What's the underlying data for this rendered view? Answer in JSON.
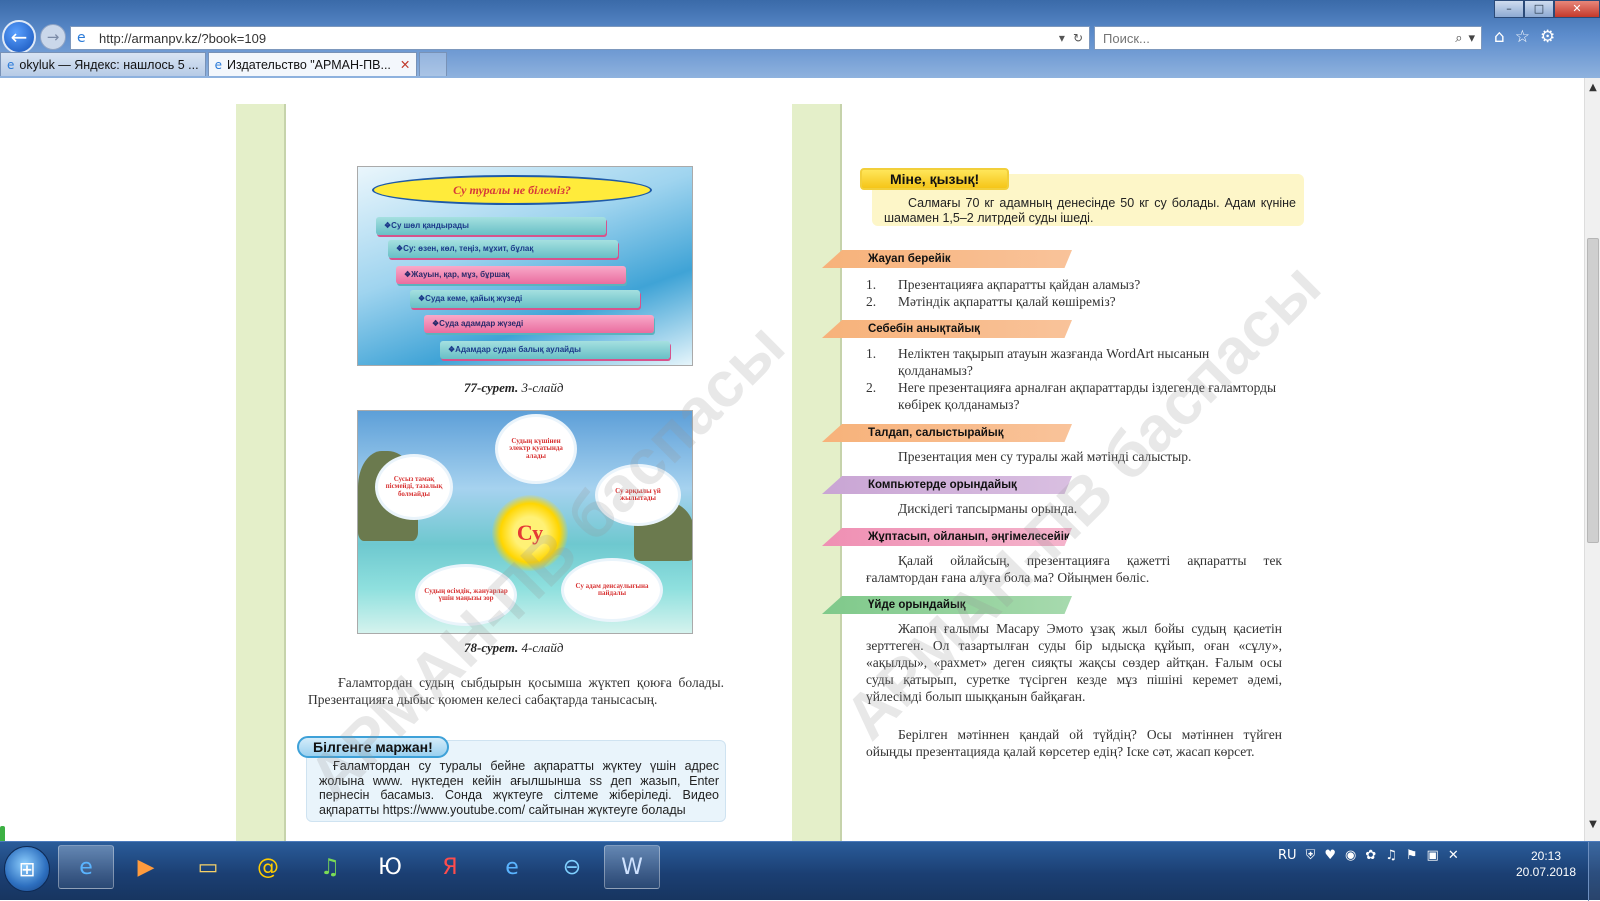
{
  "browser": {
    "url": "http://armanpv.kz/?book=109",
    "search_placeholder": "Поиск...",
    "window_controls": [
      "minimize",
      "maximize",
      "close"
    ],
    "tabs": [
      {
        "title": "okyluk — Яндекс: нашлось 5 ...",
        "active": false
      },
      {
        "title": "Издательство \"АРМАН-ПВ...",
        "active": true
      }
    ],
    "toolbar_icons": [
      "home-icon",
      "star-icon",
      "gear-icon"
    ]
  },
  "book": {
    "left_page": {
      "slide3": {
        "title": "Су туралы не білеміз?",
        "items": [
          "❖Су шөл қандырады",
          "❖Су: өзен, көл, теңіз, мұхит, бұлақ",
          "❖Жауын, қар, мұз, бұршақ",
          "❖Суда кеме, қайық жүзеді",
          "❖Суда адамдар жүзеді",
          "❖Адамдар судан балық аулайды"
        ]
      },
      "caption77_num": "77-сурет.",
      "caption77_text": " 3-слайд",
      "slide4": {
        "center": "Су",
        "clouds": [
          "Сусыз тамақ пісмейді, тазалық болмайды",
          "Судың күшінен электр қуатында алады",
          "Су арқылы үй жылытады",
          "Судың өсімдік, жануарлар үшін маңызы зор",
          "Су адам денсаулығына пайдалы"
        ]
      },
      "caption78_num": "78-сурет.",
      "caption78_text": " 4-слайд",
      "paragraph": "Ғаламтордан судың сыбдырын қосымша жүктеп қоюға болады. Презентацияға дыбыс қоюмен келесі сабақтарда танысасың.",
      "did_you_know": {
        "title": "Білгенге маржан!",
        "text": "Ғаламтордан су туралы бейне ақпаратты жүктеу үшін адрес жолына www. нүктеден кейін ағылшынша ss деп жазып, Enter пернесін басамыз. Сонда жүктеуге сілтеме жіберіледі. Видео ақпаратты https://www.youtube.com/ сайтынан жүктеуге болады"
      }
    },
    "right_page": {
      "interesting": {
        "title": "Міне, қызық!",
        "text": "Салмағы 70 кг адамның денесінде 50 кг су болады. Адам күніне шамамен 1,5–2 литрдей суды ішеді."
      },
      "answer": {
        "title": "Жауап берейік",
        "items": [
          {
            "n": "1.",
            "text": "Презентацияға ақпаратты қайдан аламыз?"
          },
          {
            "n": "2.",
            "text": "Мәтіндік ақпаратты қалай көшіреміз?"
          }
        ]
      },
      "reason": {
        "title": "Себебін анықтайық",
        "items": [
          {
            "n": "1.",
            "text": "Неліктен тақырып атауын жазғанда WordArt нысанын қолданамыз?"
          },
          {
            "n": "2.",
            "text": "Неге презентацияға арналған ақпараттарды іздегенде ғаламторды көбірек қолданамыз?"
          }
        ]
      },
      "compare": {
        "title": "Талдап, салыстырайық",
        "text": "Презентация мен су туралы жай мәтінді салыстыр."
      },
      "computer": {
        "title": "Компьютерде орындайық",
        "text": "Дискідегі тапсырманы орында."
      },
      "think": {
        "title": "Жұптасып, ойланып, әңгімелесейік",
        "text": "Қалай ойлайсың, презентацияға қажетті ақпаратты тек ғаламтордан ғана алуға бола ма? Ойыңмен бөліс."
      },
      "homework": {
        "title": "Үйде орындайық",
        "text1": "Жапон ғалымы Масару Эмото ұзақ жыл бойы судың қасиетін зерттеген. Ол тазартылған суды бір ыдысқа құйып, оған «сұлу», «ақылды», «рахмет» деген сияқты жақсы сөздер айтқан. Ғалым осы суды қатырып, суретке түсірген кезде мұз пішіні керемет әдемі, үйлесімді болып шыққанын байқаған.",
        "text2": "Берілген мәтіннен қандай ой түйдің? Осы мәтіннен түйген ойыңды презентацияда қалай көрсетер едің? Іске сәт, жасап көрсет."
      }
    },
    "watermark": "АРМАН-ПВ баспасы"
  },
  "taskbar": {
    "apps": [
      "ie-icon",
      "media-player-icon",
      "folder-icon",
      "mail-agent-icon",
      "music-icon",
      "yandex-ю-icon",
      "yandex-browser-icon",
      "ie-icon",
      "ie-alt-icon",
      "word-icon"
    ],
    "tray_lang": "RU",
    "time": "20:13",
    "date": "20.07.2018"
  }
}
